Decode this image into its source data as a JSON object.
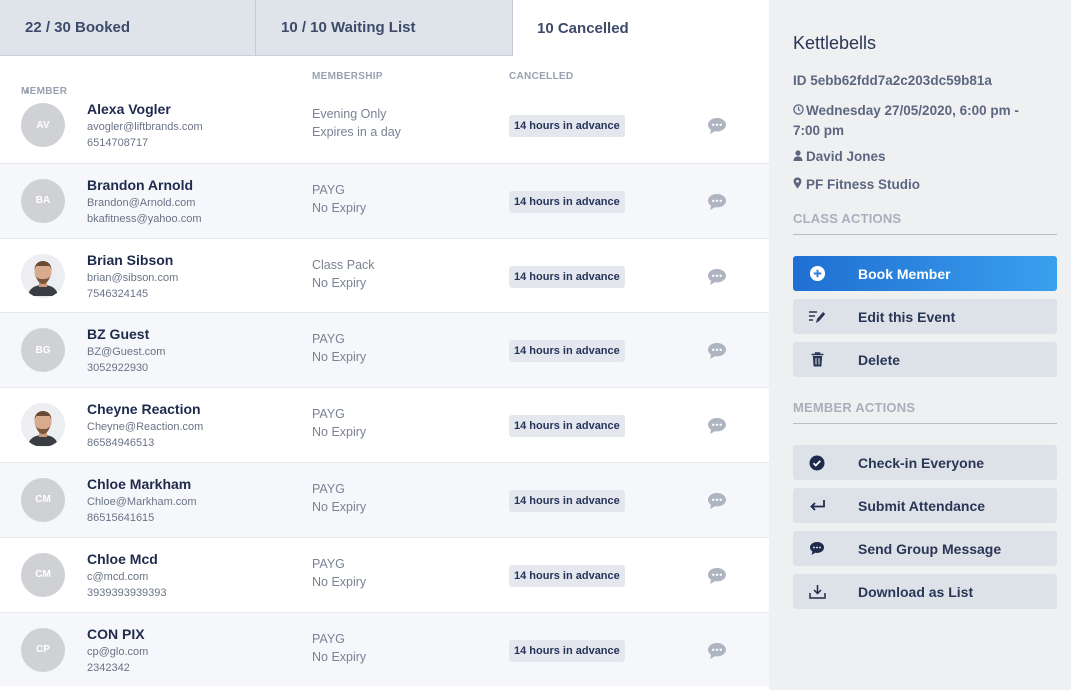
{
  "tabs": [
    {
      "label": "22 / 30 Booked"
    },
    {
      "label": "10 / 10 Waiting List"
    },
    {
      "label": "10 Cancelled"
    }
  ],
  "columns": {
    "member": "MEMBER",
    "sort_icon": "caret-up-icon",
    "membership": "MEMBERSHIP",
    "cancelled": "CANCELLED"
  },
  "members": [
    {
      "initials": "AV",
      "photo": false,
      "name": "Alexa Vogler",
      "line1": "avogler@liftbrands.com",
      "line2": "6514708717",
      "membership": "Evening Only",
      "expiry": "Expires in a day",
      "cancelled": "14 hours in advance"
    },
    {
      "initials": "BA",
      "photo": false,
      "name": "Brandon Arnold",
      "line1": "Brandon@Arnold.com",
      "line2": "bkafitness@yahoo.com",
      "membership": "PAYG",
      "expiry": "No Expiry",
      "cancelled": "14 hours in advance"
    },
    {
      "initials": "",
      "photo": true,
      "name": "Brian Sibson",
      "line1": "brian@sibson.com",
      "line2": "7546324145",
      "membership": "Class Pack",
      "expiry": "No Expiry",
      "cancelled": "14 hours in advance"
    },
    {
      "initials": "BG",
      "photo": false,
      "name": "BZ Guest",
      "line1": "BZ@Guest.com",
      "line2": "3052922930",
      "membership": "PAYG",
      "expiry": "No Expiry",
      "cancelled": "14 hours in advance"
    },
    {
      "initials": "",
      "photo": true,
      "name": "Cheyne Reaction",
      "line1": "Cheyne@Reaction.com",
      "line2": "86584946513",
      "membership": "PAYG",
      "expiry": "No Expiry",
      "cancelled": "14 hours in advance"
    },
    {
      "initials": "CM",
      "photo": false,
      "name": "Chloe Markham",
      "line1": "Chloe@Markham.com",
      "line2": "86515641615",
      "membership": "PAYG",
      "expiry": "No Expiry",
      "cancelled": "14 hours in advance"
    },
    {
      "initials": "CM",
      "photo": false,
      "name": "Chloe Mcd",
      "line1": "c@mcd.com",
      "line2": "3939393939393",
      "membership": "PAYG",
      "expiry": "No Expiry",
      "cancelled": "14 hours in advance"
    },
    {
      "initials": "CP",
      "photo": false,
      "name": "CON PIX",
      "line1": "cp@glo.com",
      "line2": "2342342",
      "membership": "PAYG",
      "expiry": "No Expiry",
      "cancelled": "14 hours in advance"
    }
  ],
  "event": {
    "title": "Kettlebells",
    "id": "ID 5ebb62fdd7a2c203dc59b81a",
    "datetime": "Wednesday 27/05/2020, 6:00 pm - 7:00 pm",
    "instructor": "David Jones",
    "location": "PF Fitness Studio"
  },
  "class_actions": {
    "heading": "CLASS ACTIONS",
    "items": [
      {
        "label": "Book Member",
        "icon": "plus-circle-icon"
      },
      {
        "label": "Edit this Event",
        "icon": "edit-icon"
      },
      {
        "label": "Delete",
        "icon": "trash-icon"
      }
    ]
  },
  "member_actions": {
    "heading": "MEMBER ACTIONS",
    "items": [
      {
        "label": "Check-in Everyone",
        "icon": "check-circle-icon"
      },
      {
        "label": "Submit Attendance",
        "icon": "enter-arrow-icon"
      },
      {
        "label": "Send Group Message",
        "icon": "chat-bubble-icon"
      },
      {
        "label": "Download as List",
        "icon": "download-icon"
      }
    ]
  },
  "colors": {
    "accent_start": "#1f6fd2",
    "accent_end": "#3aa0ee",
    "panel": "#eff0f2",
    "button": "#dde1e8"
  }
}
